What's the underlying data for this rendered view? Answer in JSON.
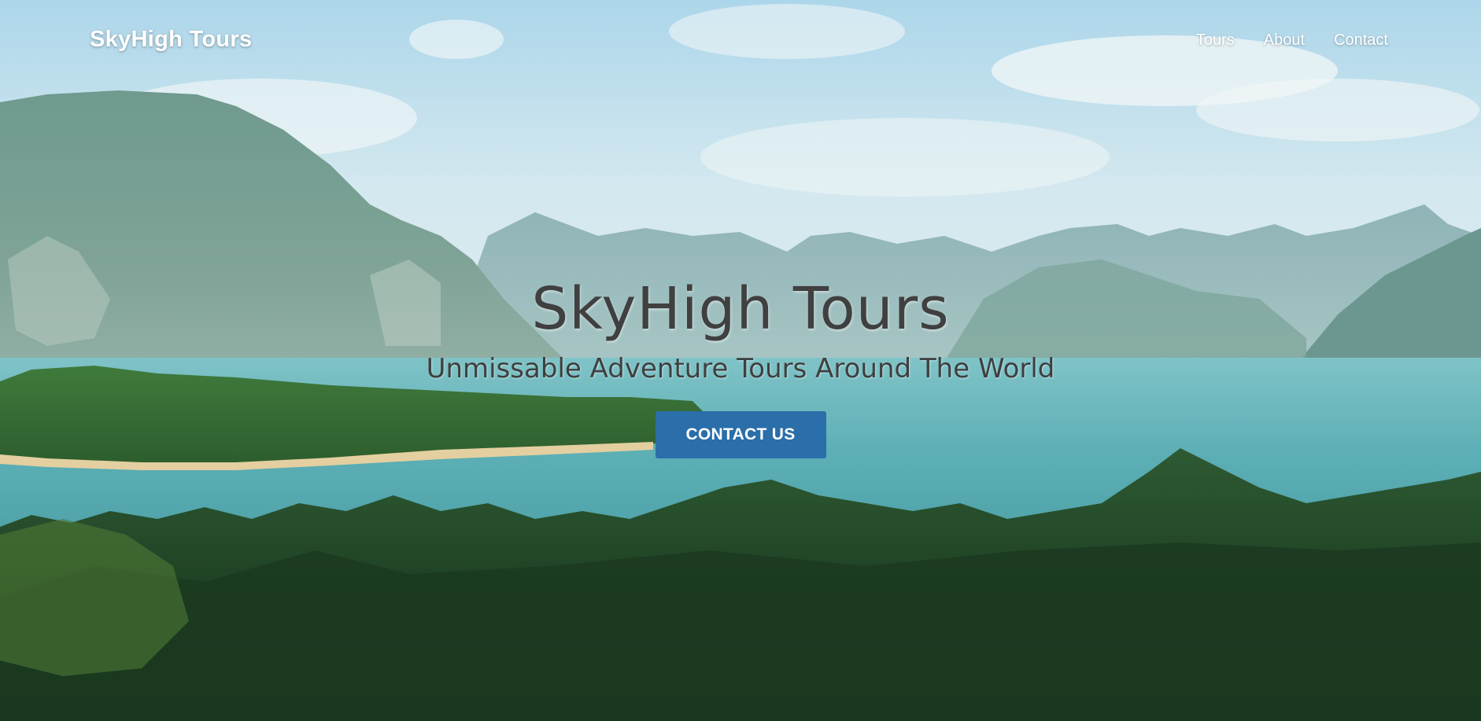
{
  "navbar": {
    "brand": "SkyHigh Tours",
    "links": [
      "Tours",
      "About",
      "Contact"
    ]
  },
  "hero": {
    "title": "SkyHigh Tours",
    "subtitle": "Unmissable Adventure Tours Around The World",
    "cta_label": "CONTACT US"
  },
  "colors": {
    "cta_background": "#2a6eaa",
    "heading_text": "#404040",
    "nav_text": "#ffffff"
  },
  "background": {
    "scene": "lake-mountains-forest-photo"
  }
}
